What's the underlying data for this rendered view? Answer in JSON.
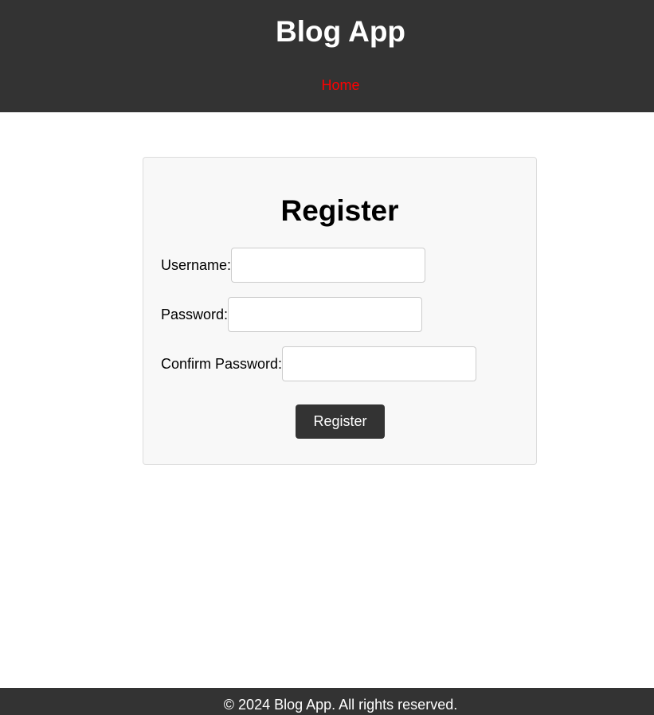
{
  "header": {
    "title": "Blog App",
    "nav": [
      {
        "label": "Home"
      }
    ]
  },
  "register_form": {
    "title": "Register",
    "fields": {
      "username": {
        "label": "Username:",
        "value": ""
      },
      "password": {
        "label": "Password:",
        "value": ""
      },
      "confirm_password": {
        "label": "Confirm Password:",
        "value": ""
      }
    },
    "submit_label": "Register"
  },
  "footer": {
    "text": "© 2024 Blog App. All rights reserved."
  },
  "colors": {
    "header_bg": "#333333",
    "nav_link": "#ff0000",
    "card_bg": "#f8f8f8",
    "button_bg": "#333333",
    "footer_bg": "#333333"
  }
}
